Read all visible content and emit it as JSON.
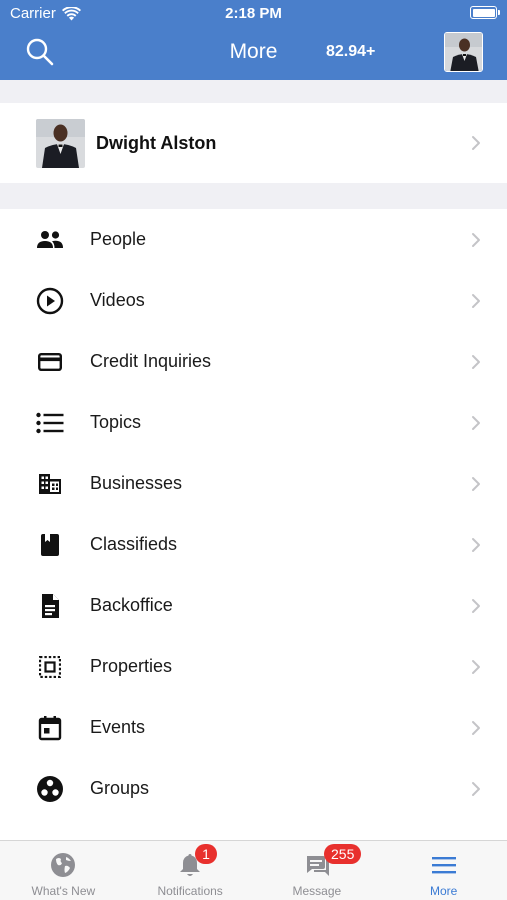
{
  "status_bar": {
    "carrier": "Carrier",
    "time": "2:18 PM"
  },
  "nav": {
    "title": "More",
    "score": "82.94+",
    "search_icon": "search-icon"
  },
  "profile": {
    "name": "Dwight Alston"
  },
  "menu": {
    "items": [
      {
        "label": "People",
        "icon": "people-icon"
      },
      {
        "label": "Videos",
        "icon": "play-circle-icon"
      },
      {
        "label": "Credit Inquiries",
        "icon": "credit-card-icon"
      },
      {
        "label": "Topics",
        "icon": "list-icon"
      },
      {
        "label": "Businesses",
        "icon": "building-icon"
      },
      {
        "label": "Classifieds",
        "icon": "book-icon"
      },
      {
        "label": "Backoffice",
        "icon": "document-icon"
      },
      {
        "label": "Properties",
        "icon": "select-frame-icon"
      },
      {
        "label": "Events",
        "icon": "calendar-icon"
      },
      {
        "label": "Groups",
        "icon": "groups-icon"
      }
    ]
  },
  "tabbar": {
    "tabs": [
      {
        "label": "What's New",
        "icon": "globe-icon",
        "badge": ""
      },
      {
        "label": "Notifications",
        "icon": "bell-icon",
        "badge": "1"
      },
      {
        "label": "Message",
        "icon": "chat-icon",
        "badge": "255"
      },
      {
        "label": "More",
        "icon": "menu-icon",
        "badge": ""
      }
    ],
    "active": "More"
  },
  "colors": {
    "header": "#4a7fcb",
    "accent": "#3b7bd4",
    "badge": "#e8302d",
    "section_bg": "#f0f0f4"
  }
}
